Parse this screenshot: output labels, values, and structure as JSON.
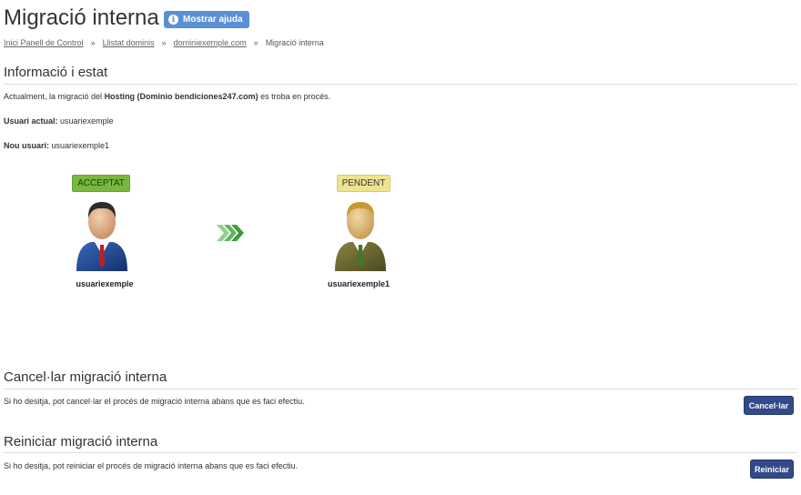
{
  "header": {
    "title": "Migració interna",
    "help_label": "Mostrar ajuda"
  },
  "breadcrumb": {
    "items": [
      "Inici Panell de Control",
      "Llistat dominis",
      "dominiexemple.com"
    ],
    "current": "Migració interna",
    "separator": "»"
  },
  "status": {
    "title": "Informació i estat",
    "line1": {
      "prefix": "Actualment, la migració del ",
      "bold": "Hosting (Dominio bendiciones247.com)",
      "suffix": " es troba en procés."
    },
    "current_user": {
      "label": "Usuari actual:",
      "value": "usuariexemple"
    },
    "new_user": {
      "label": "Nou usuari:",
      "value": "usuariexemple1"
    }
  },
  "migration": {
    "from": {
      "badge": "ACCEPTAT",
      "name": "usuariexemple",
      "icon": "user-blue-icon"
    },
    "to": {
      "badge": "PENDENT",
      "name": "usuariexemple1",
      "icon": "user-gold-icon"
    },
    "arrow_icon": "triple-chevron-right-icon"
  },
  "cancel": {
    "title": "Cancel·lar migració interna",
    "text": "Si ho desitja, pot cancel·lar el procés de migració interna abans que es faci efectiu.",
    "button": "Cancel·lar"
  },
  "restart": {
    "title": "Reiniciar migració interna",
    "text": "Si ho desitja, pot reiniciar el procés de migració interna abans que es faci efectiu.",
    "button": "Reiniciar"
  },
  "colors": {
    "accepted": "#79b73f",
    "pending": "#efe48e",
    "button": "#32498a",
    "help_button": "#5b8fd6"
  }
}
